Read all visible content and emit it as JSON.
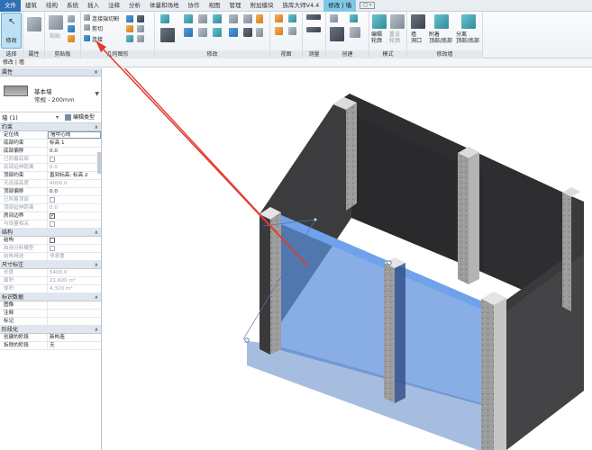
{
  "menu": {
    "tabs": [
      "文件",
      "建筑",
      "结构",
      "系统",
      "插入",
      "注释",
      "分析",
      "体量和场地",
      "协作",
      "视图",
      "管理",
      "附加模块",
      "族库大师V4.4",
      "修改 | 墙"
    ],
    "extra": "□ •"
  },
  "ribbon": {
    "modify_label": "修改",
    "clipboard": {
      "paste": "粘贴",
      "title": "剪贴板"
    },
    "geometry": {
      "join_cut": "连接端切割",
      "cut": "剪切",
      "join": "连接",
      "title": "几何图形"
    },
    "modify_title": "修改",
    "view_title": "视图",
    "measure_title": "测量",
    "create_title": "创建",
    "mode": {
      "edit_profile": "编辑\n轮廓",
      "reset_profile": "重设\n轮廓",
      "title": "模式"
    },
    "modify_wall": {
      "opening": "墙\n洞口",
      "attach": "附着\n顶部/底部",
      "detach": "分离\n顶部/底部",
      "title": "修改墙"
    },
    "select": "选择",
    "props_short": "属性"
  },
  "options_bar": "修改 | 墙",
  "properties": {
    "title": "属性",
    "close": "×",
    "type_family": "基本墙",
    "type_name": "常规 - 200mm",
    "instance": "墙 (1)",
    "edit_type": "编辑类型",
    "groups": [
      {
        "name": "约束",
        "rows": [
          {
            "k": "定位线",
            "v": "墙中心线",
            "style": "boxed"
          },
          {
            "k": "底部约束",
            "v": "标高 1"
          },
          {
            "k": "底部偏移",
            "v": "0.0"
          },
          {
            "k": "已附着底部",
            "v": "",
            "check": false,
            "dis": true
          },
          {
            "k": "底部延伸距离",
            "v": "0.0",
            "dis": true
          },
          {
            "k": "顶部约束",
            "v": "直到标高: 标高 2"
          },
          {
            "k": "无连接高度",
            "v": "4000.0",
            "dis": true
          },
          {
            "k": "顶部偏移",
            "v": "0.0"
          },
          {
            "k": "已附着顶部",
            "v": "",
            "check": false,
            "dis": true
          },
          {
            "k": "顶部延伸距离",
            "v": "0.0",
            "dis": true
          },
          {
            "k": "房间边界",
            "v": "",
            "check": true
          },
          {
            "k": "与体量相关",
            "v": "",
            "check": false,
            "dis": true
          }
        ]
      },
      {
        "name": "结构",
        "rows": [
          {
            "k": "结构",
            "v": "",
            "check": false
          },
          {
            "k": "启用分析模型",
            "v": "",
            "check": false,
            "dis": true
          },
          {
            "k": "结构用途",
            "v": "非承重",
            "dis": true
          }
        ]
      },
      {
        "name": "尺寸标注",
        "rows": [
          {
            "k": "长度",
            "v": "5400.0",
            "dis": true
          },
          {
            "k": "面积",
            "v": "21.600 m²",
            "dis": true
          },
          {
            "k": "体积",
            "v": "4.320 m³",
            "dis": true
          }
        ]
      },
      {
        "name": "标识数据",
        "rows": [
          {
            "k": "图像",
            "v": ""
          },
          {
            "k": "注释",
            "v": ""
          },
          {
            "k": "标记",
            "v": ""
          }
        ]
      },
      {
        "name": "阶段化",
        "rows": [
          {
            "k": "创建的阶段",
            "v": "新构造"
          },
          {
            "k": "拆除的阶段",
            "v": "无"
          }
        ]
      }
    ],
    "toggle": "∧"
  },
  "colors": {
    "wall_dark": "#2e2e30",
    "wall_face": "#4a4a4c",
    "column": "#9a9a9a",
    "column_top": "#dcdcdc",
    "selected_wall": "#4f86d6",
    "arrow": "#e23b2e"
  }
}
